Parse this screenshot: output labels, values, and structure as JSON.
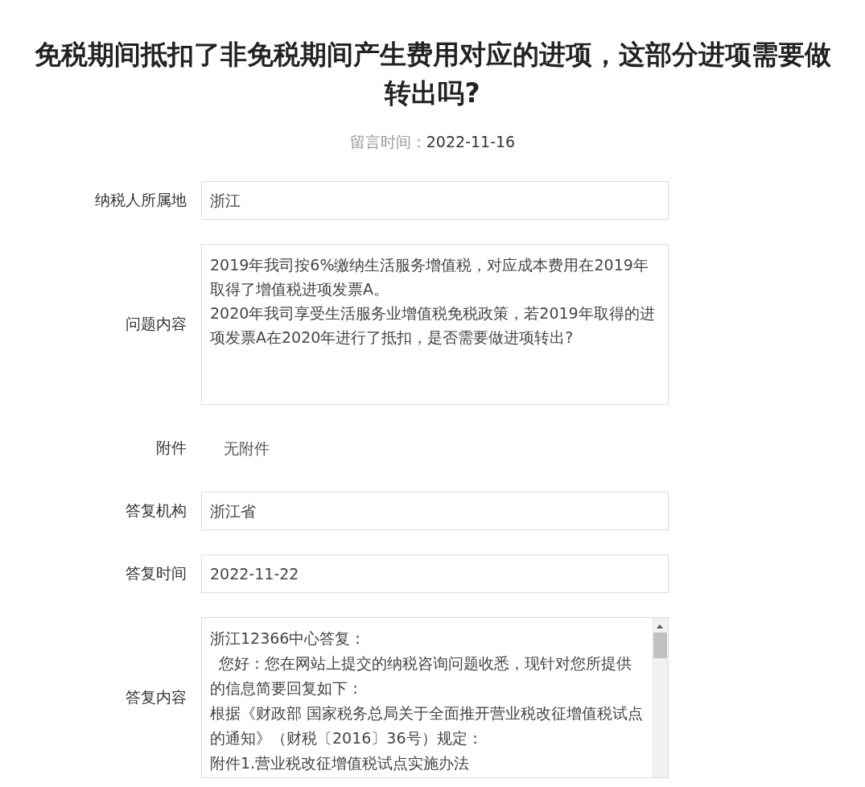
{
  "title": "免税期间抵扣了非免税期间产生费用对应的进项，这部分进项需要做转出吗?",
  "meta": {
    "label": "留言时间：",
    "value": "2022-11-16"
  },
  "fields": [
    {
      "kind": "input",
      "label": "纳税人所属地",
      "value": "浙江"
    },
    {
      "kind": "textarea",
      "label": "问题内容",
      "value": "2019年我司按6%缴纳生活服务增值税，对应成本费用在2019年取得了增值税进项发票A。\n2020年我司享受生活服务业增值税免税政策，若2019年取得的进项发票A在2020年进行了抵扣，是否需要做进项转出?"
    },
    {
      "kind": "plain",
      "label": "附件",
      "value": "无附件"
    },
    {
      "kind": "input",
      "label": "答复机构",
      "value": "浙江省"
    },
    {
      "kind": "input",
      "label": "答复时间",
      "value": "2022-11-22"
    },
    {
      "kind": "scroll",
      "label": "答复内容",
      "paragraphs": [
        {
          "text": "浙江12366中心答复：",
          "indent": false
        },
        {
          "text": "您好：您在网站上提交的纳税咨询问题收悉，现针对您所提供的信息简要回复如下：",
          "indent": true
        },
        {
          "text": "根据《财政部 国家税务总局关于全面推开营业税改征增值税试点的通知》（财税〔2016〕36号）规定：",
          "indent": false
        },
        {
          "text": "附件1.营业税改征增值税试点实施办法",
          "indent": false
        }
      ]
    }
  ]
}
